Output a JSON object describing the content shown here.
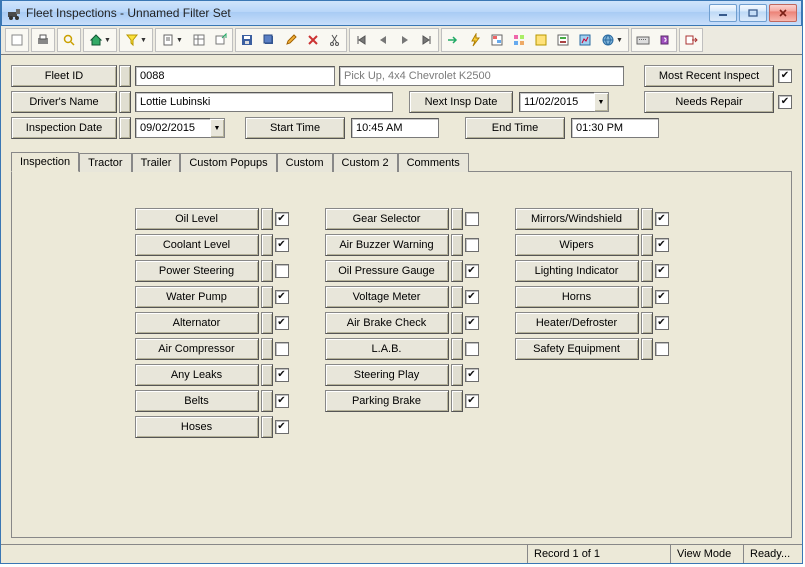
{
  "window": {
    "title": "Fleet Inspections - Unnamed Filter Set"
  },
  "labels": {
    "fleet_id": "Fleet ID",
    "drivers_name": "Driver's Name",
    "inspection_date": "Inspection Date",
    "start_time": "Start Time",
    "end_time": "End Time",
    "next_insp_date": "Next Insp Date",
    "most_recent": "Most Recent Inspect",
    "needs_repair": "Needs Repair"
  },
  "fields": {
    "fleet_id": "0088",
    "vehicle_desc": "Pick Up, 4x4 Chevrolet K2500",
    "drivers_name": "Lottie Lubinski",
    "inspection_date": "09/02/2015",
    "next_insp_date": "11/02/2015",
    "start_time": "10:45 AM",
    "end_time": "01:30 PM",
    "most_recent_checked": true,
    "needs_repair_checked": true
  },
  "tabs": [
    "Inspection",
    "Tractor",
    "Trailer",
    "Custom Popups",
    "Custom",
    "Custom 2",
    "Comments"
  ],
  "active_tab": 0,
  "cols": [
    [
      {
        "label": "Oil Level",
        "checked": true
      },
      {
        "label": "Coolant Level",
        "checked": true
      },
      {
        "label": "Power Steering",
        "checked": false
      },
      {
        "label": "Water Pump",
        "checked": true
      },
      {
        "label": "Alternator",
        "checked": true
      },
      {
        "label": "Air Compressor",
        "checked": false
      },
      {
        "label": "Any Leaks",
        "checked": true
      },
      {
        "label": "Belts",
        "checked": true
      },
      {
        "label": "Hoses",
        "checked": true
      }
    ],
    [
      {
        "label": "Gear Selector",
        "checked": false
      },
      {
        "label": "Air Buzzer Warning",
        "checked": false
      },
      {
        "label": "Oil Pressure Gauge",
        "checked": true
      },
      {
        "label": "Voltage Meter",
        "checked": true
      },
      {
        "label": "Air Brake Check",
        "checked": true
      },
      {
        "label": "L.A.B.",
        "checked": false
      },
      {
        "label": "Steering Play",
        "checked": true
      },
      {
        "label": "Parking Brake",
        "checked": true
      }
    ],
    [
      {
        "label": "Mirrors/Windshield",
        "checked": true
      },
      {
        "label": "Wipers",
        "checked": true
      },
      {
        "label": "Lighting Indicator",
        "checked": true
      },
      {
        "label": "Horns",
        "checked": true
      },
      {
        "label": "Heater/Defroster",
        "checked": true
      },
      {
        "label": "Safety Equipment",
        "checked": false
      }
    ]
  ],
  "status": {
    "record": "Record 1 of 1",
    "mode": "View Mode",
    "ready": "Ready..."
  }
}
